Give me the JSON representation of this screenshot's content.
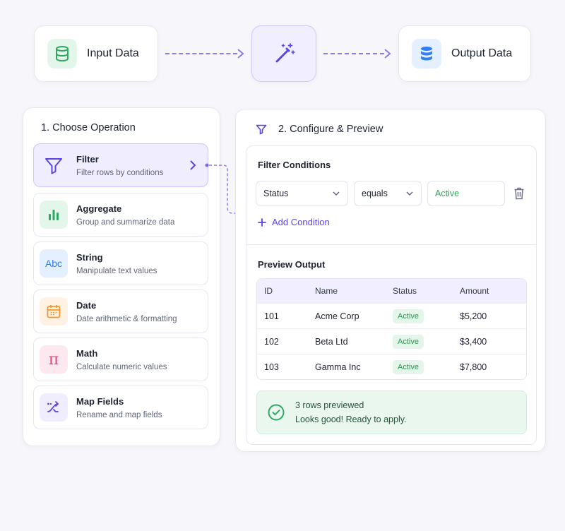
{
  "pipeline": {
    "input_label": "Input Data",
    "input_icon": "database-icon",
    "transform_icon": "magic-wand-icon",
    "output_label": "Output Data",
    "output_icon": "database-filled-icon",
    "accent_color": "#7c6cf0"
  },
  "operations": {
    "title": "1. Choose Operation",
    "items": [
      {
        "name": "Filter",
        "desc": "Filter rows by conditions",
        "icon": "filter-icon",
        "selected": true
      },
      {
        "name": "Aggregate",
        "desc": "Group and summarize data",
        "icon": "bar-chart-icon"
      },
      {
        "name": "String",
        "desc": "Manipulate text values",
        "icon": "abc-text-icon",
        "icon_text": "Abc"
      },
      {
        "name": "Date",
        "desc": "Date arithmetic & formatting",
        "icon": "calendar-icon"
      },
      {
        "name": "Math",
        "desc": "Calculate numeric values",
        "icon": "pi-icon",
        "icon_text": "π"
      },
      {
        "name": "Map Fields",
        "desc": "Rename and map fields",
        "icon": "shuffle-arrows-icon"
      }
    ]
  },
  "configure": {
    "title": "2. Configure & Preview",
    "filter_section_title": "Filter Conditions",
    "condition": {
      "field": "Status",
      "operator": "equals",
      "value": "Active"
    },
    "add_condition_label": "Add Condition",
    "preview_title": "Preview Output",
    "columns": [
      "ID",
      "Name",
      "Status",
      "Amount"
    ],
    "rows": [
      {
        "id": "101",
        "name": "Acme Corp",
        "status": "Active",
        "amount": "$5,200"
      },
      {
        "id": "102",
        "name": "Beta Ltd",
        "status": "Active",
        "amount": "$3,400"
      },
      {
        "id": "103",
        "name": "Gamma Inc",
        "status": "Active",
        "amount": "$7,800"
      }
    ],
    "success_count": "3 rows previewed",
    "success_message": "Looks good! Ready to apply."
  }
}
